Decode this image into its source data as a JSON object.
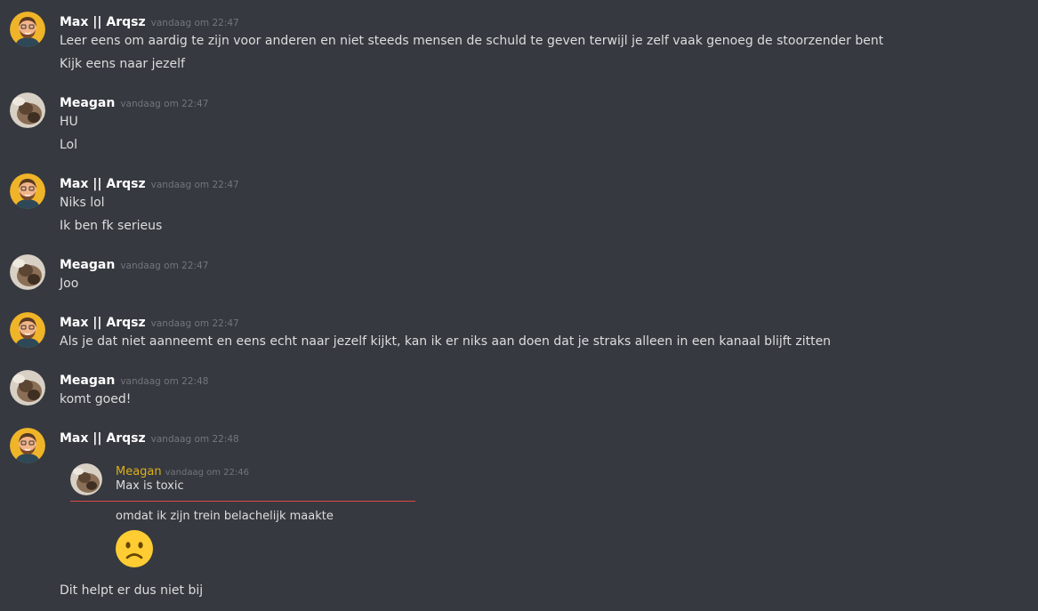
{
  "users": {
    "max": "Max || Arqsz",
    "meagan": "Meagan"
  },
  "messages": [
    {
      "author": "Max || Arqsz",
      "timestamp": "vandaag om 22:47",
      "lines": [
        "Leer eens om aardig te zijn voor anderen en niet steeds mensen de schuld te geven terwijl je zelf vaak genoeg de stoorzender bent",
        "Kijk eens naar jezelf"
      ]
    },
    {
      "author": "Meagan",
      "timestamp": "vandaag om 22:47",
      "lines": [
        "HU",
        "Lol"
      ]
    },
    {
      "author": "Max || Arqsz",
      "timestamp": "vandaag om 22:47",
      "lines": [
        "Niks lol",
        "Ik ben fk serieus"
      ]
    },
    {
      "author": "Meagan",
      "timestamp": "vandaag om 22:47",
      "lines": [
        "Joo"
      ]
    },
    {
      "author": "Max || Arqsz",
      "timestamp": "vandaag om 22:47",
      "lines": [
        "Als je dat niet aanneemt en eens echt naar jezelf kijkt, kan ik er niks aan doen dat je straks alleen in een kanaal blijft zitten"
      ]
    },
    {
      "author": "Meagan",
      "timestamp": "vandaag om 22:48",
      "lines": [
        "komt goed!"
      ]
    },
    {
      "author": "Max || Arqsz",
      "timestamp": "vandaag om 22:48",
      "quote": {
        "author": "Meagan",
        "timestamp": "vandaag om 22:46",
        "text": "Max is toxic",
        "subtext": "omdat ik zijn trein belachelijk maakte",
        "emoji": "frowning-face"
      },
      "lines": [
        "Dit helpt er dus niet bij"
      ]
    }
  ],
  "colors": {
    "background": "#36393f",
    "username": "#ffffff",
    "timestamp": "#72767d",
    "text": "#dcddde",
    "quote_author": "#dcb01a",
    "quote_divider": "#e04848"
  }
}
